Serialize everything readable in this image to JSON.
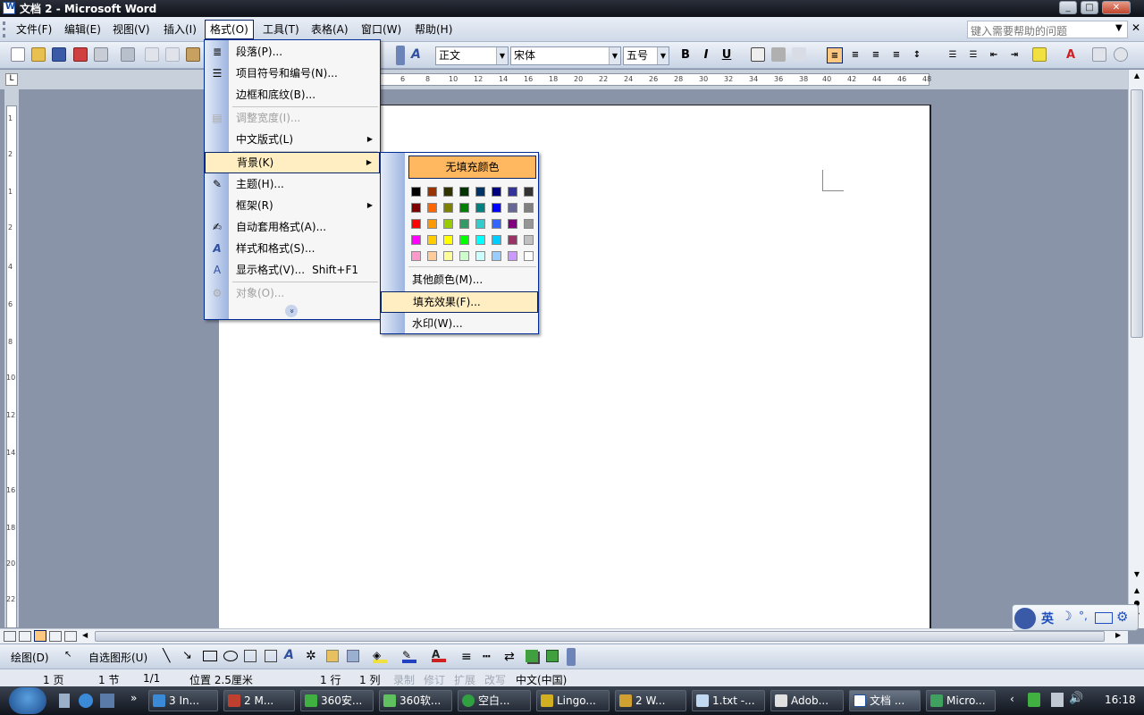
{
  "titlebar": {
    "title": "文档 2 - Microsoft Word",
    "min": "_",
    "max": "□",
    "close": "✕"
  },
  "menubar": {
    "items": [
      "文件(F)",
      "编辑(E)",
      "视图(V)",
      "插入(I)",
      "格式(O)",
      "工具(T)",
      "表格(A)",
      "窗口(W)",
      "帮助(H)"
    ],
    "help_placeholder": "键入需要帮助的问题"
  },
  "toolbar": {
    "style": "正文",
    "font": "宋体",
    "size": "五号",
    "bold": "B",
    "italic": "I",
    "underline": "U"
  },
  "ruler": {
    "ticks": [
      "6",
      "8",
      "10",
      "12",
      "14",
      "16",
      "18",
      "20",
      "22",
      "24",
      "26",
      "28",
      "30",
      "32",
      "34",
      "36",
      "38",
      "40",
      "42",
      "44",
      "46",
      "48"
    ],
    "vticks": [
      "1",
      "2",
      "1",
      "2",
      "4",
      "6",
      "8",
      "10",
      "12",
      "14",
      "16",
      "18",
      "20",
      "22"
    ]
  },
  "format_menu": {
    "items": [
      {
        "label": "段落(P)...",
        "icon": "paragraph-icon"
      },
      {
        "label": "项目符号和编号(N)...",
        "icon": "list-icon"
      },
      {
        "label": "边框和底纹(B)..."
      },
      {
        "label": "调整宽度(I)...",
        "disabled": true
      },
      {
        "label": "中文版式(L)",
        "submenu": true
      },
      {
        "label": "背景(K)",
        "submenu": true,
        "highlighted": true
      },
      {
        "label": "主题(H)..."
      },
      {
        "label": "框架(R)",
        "submenu": true
      },
      {
        "label": "自动套用格式(A)..."
      },
      {
        "label": "样式和格式(S)..."
      },
      {
        "label": "显示格式(V)...",
        "shortcut": "Shift+F1"
      },
      {
        "label": "对象(O)...",
        "disabled": true
      }
    ],
    "expand": "»"
  },
  "background_menu": {
    "no_fill": "无填充颜色",
    "colors": [
      [
        "#000000",
        "#993300",
        "#333300",
        "#003300",
        "#003366",
        "#000080",
        "#333399",
        "#333333"
      ],
      [
        "#800000",
        "#ff6600",
        "#808000",
        "#008000",
        "#008080",
        "#0000ff",
        "#666699",
        "#808080"
      ],
      [
        "#ff0000",
        "#ff9900",
        "#99cc00",
        "#339966",
        "#33cccc",
        "#3366ff",
        "#800080",
        "#969696"
      ],
      [
        "#ff00ff",
        "#ffcc00",
        "#ffff00",
        "#00ff00",
        "#00ffff",
        "#00ccff",
        "#993366",
        "#c0c0c0"
      ],
      [
        "#ff99cc",
        "#ffcc99",
        "#ffff99",
        "#ccffcc",
        "#ccffff",
        "#99ccff",
        "#cc99ff",
        "#ffffff"
      ]
    ],
    "more_colors": "其他颜色(M)...",
    "fill_effects": "填充效果(F)...",
    "watermark": "水印(W)..."
  },
  "drawbar": {
    "draw": "绘图(D)",
    "autoshapes": "自选图形(U)"
  },
  "statusbar": {
    "page": "1 页",
    "section": "1 节",
    "pages": "1/1",
    "position": "位置 2.5厘米",
    "line": "1 行",
    "col": "1 列",
    "rec": "录制",
    "trk": "修订",
    "ext": "扩展",
    "ovr": "改写",
    "lang": "中文(中国)"
  },
  "taskbar": {
    "tasks": [
      "3 In...",
      "2 M...",
      "360安...",
      "360软...",
      "空白...",
      "Lingo...",
      "2 W...",
      "1.txt -...",
      "Adob...",
      "文档 ...",
      "Micro..."
    ],
    "clock": "16:18",
    "ime": "英"
  }
}
